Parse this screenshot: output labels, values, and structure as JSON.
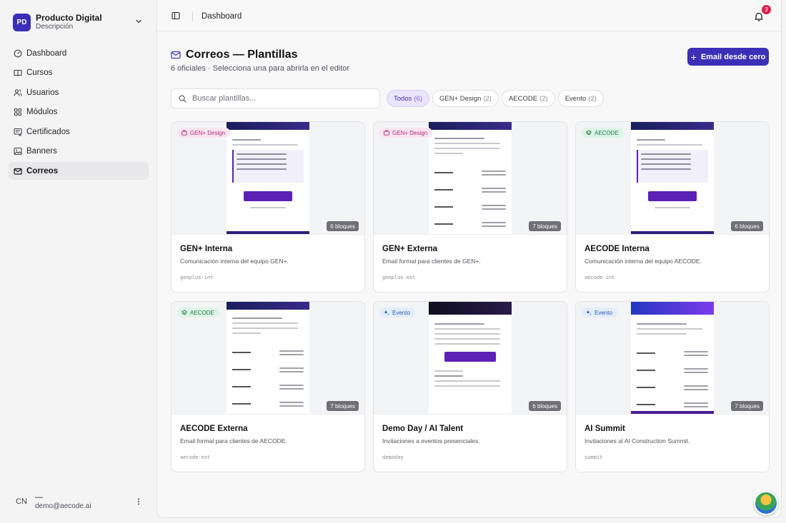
{
  "brand": {
    "initials": "PD",
    "title": "Producto Digital",
    "subtitle": "Descripción"
  },
  "nav": [
    {
      "label": "Dashboard",
      "icon": "dashboard-icon"
    },
    {
      "label": "Cursos",
      "icon": "book-icon"
    },
    {
      "label": "Usuarios",
      "icon": "users-icon"
    },
    {
      "label": "Módulos",
      "icon": "grid-icon"
    },
    {
      "label": "Certificados",
      "icon": "certificate-icon"
    },
    {
      "label": "Banners",
      "icon": "image-icon"
    },
    {
      "label": "Correos",
      "icon": "mail-icon",
      "active": true
    }
  ],
  "user": {
    "initials": "CN",
    "name": "—",
    "email": "demo@aecode.ai"
  },
  "topbar": {
    "breadcrumb": "Dashboard",
    "notifications": "3"
  },
  "page": {
    "title": "Correos — Plantillas",
    "subtitle": "6 oficiales · Selecciona una para abrirla en el editor",
    "primary_button": "Email desde cero",
    "search_placeholder": "Buscar plantillas..."
  },
  "filters": [
    {
      "label": "Todos",
      "count": "(6)",
      "active": true
    },
    {
      "label": "GEN+ Design",
      "count": "(2)"
    },
    {
      "label": "AECODE",
      "count": "(2)"
    },
    {
      "label": "Evento",
      "count": "(2)"
    }
  ],
  "templates": [
    {
      "title": "GEN+ Interna",
      "description": "Comunicación interna del equipo GEN+.",
      "slug": "genplus-int",
      "tag": "GEN+ Design",
      "tag_type": "gen",
      "blocks": "6 bloques",
      "preview": "interna"
    },
    {
      "title": "GEN+ Externa",
      "description": "Email formal para clientes de GEN+.",
      "slug": "genplus-ext",
      "tag": "GEN+ Design",
      "tag_type": "gen",
      "blocks": "7 bloques",
      "preview": "externa"
    },
    {
      "title": "AECODE Interna",
      "description": "Comunicación interna del equipo AECODE.",
      "slug": "aecode-int",
      "tag": "AECODE",
      "tag_type": "aecode",
      "blocks": "6 bloques",
      "preview": "interna"
    },
    {
      "title": "AECODE Externa",
      "description": "Email formal para clientes de AECODE.",
      "slug": "aecode-ext",
      "tag": "AECODE",
      "tag_type": "aecode",
      "blocks": "7 bloques",
      "preview": "externa"
    },
    {
      "title": "Demo Day / AI Talent",
      "description": "Invitaciones a eventos presenciales.",
      "slug": "demoday",
      "tag": "Evento",
      "tag_type": "evento",
      "blocks": "6 bloques",
      "preview": "demo"
    },
    {
      "title": "AI Summit",
      "description": "Invitaciones al AI Construction Summit.",
      "slug": "summit",
      "tag": "Evento",
      "tag_type": "evento",
      "blocks": "7 bloques",
      "preview": "summit"
    }
  ]
}
